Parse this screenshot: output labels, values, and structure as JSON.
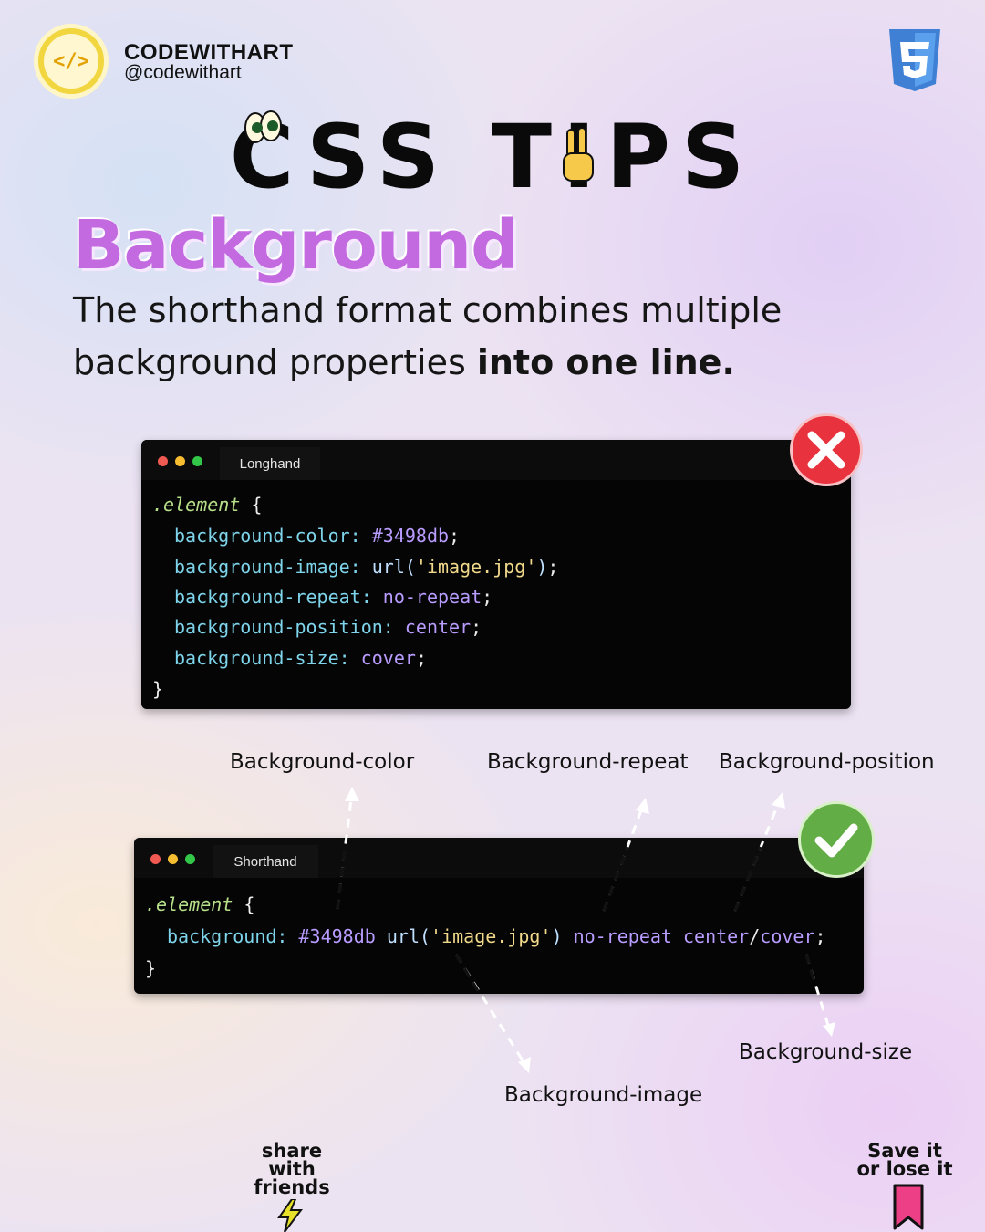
{
  "brand": {
    "name": "CODEWITHART",
    "handle": "@codewithart",
    "logo_text": "</>"
  },
  "badge_logo": "css3-icon",
  "title": "CSS TIPS",
  "subtitle": "Background",
  "description": {
    "normal": "The shorthand format combines multiple background properties ",
    "bold": "into one line."
  },
  "longhand": {
    "tab": "Longhand",
    "selector": ".element",
    "open": " {",
    "close": "}",
    "lines": [
      {
        "prop": "background-color",
        "parts": [
          {
            "t": "#3498db",
            "c": "val"
          }
        ]
      },
      {
        "prop": "background-image",
        "parts": [
          {
            "t": "url(",
            "c": "fn"
          },
          {
            "t": "'image.jpg'",
            "c": "str"
          },
          {
            "t": ")",
            "c": "fn"
          }
        ]
      },
      {
        "prop": "background-repeat",
        "parts": [
          {
            "t": "no-repeat",
            "c": "val"
          }
        ]
      },
      {
        "prop": "background-position",
        "parts": [
          {
            "t": "center",
            "c": "val"
          }
        ]
      },
      {
        "prop": "background-size",
        "parts": [
          {
            "t": "cover",
            "c": "val"
          }
        ]
      }
    ]
  },
  "shorthand": {
    "tab": "Shorthand",
    "selector": ".element",
    "open": " {",
    "close": "}",
    "prop": "background",
    "value_color": "#3498db",
    "value_url_fn": "url(",
    "value_url_str": "'image.jpg'",
    "value_url_close": ")",
    "value_repeat": "no-repeat",
    "value_position": "center",
    "value_slash": "/",
    "value_size": "cover",
    "semicolon": ";"
  },
  "annotations": {
    "color": "Background-color",
    "repeat": "Background-repeat",
    "position": "Background-position",
    "size": "Background-size",
    "image": "Background-image"
  },
  "footer": {
    "share": [
      "share",
      "with",
      "friends"
    ],
    "save": [
      "Save it",
      "or lose it"
    ]
  },
  "colors": {
    "accent": "#c36ae0",
    "wrong": "#e8323d",
    "right": "#62ad45"
  }
}
